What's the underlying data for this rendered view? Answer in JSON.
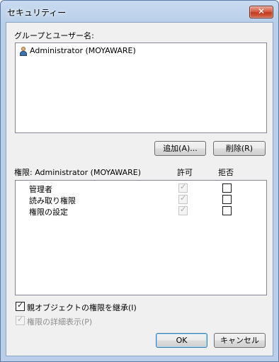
{
  "window": {
    "title": "セキュリティー",
    "close_glyph": "✕"
  },
  "users_section": {
    "label": "グループとユーザー名:",
    "users": [
      {
        "name": "Administrator (MOYAWARE)",
        "icon": "user-icon"
      }
    ]
  },
  "buttons": {
    "add": "追加(A)...",
    "remove": "削除(R)",
    "ok": "OK",
    "cancel": "キャンセル"
  },
  "permissions": {
    "title": "権限: Administrator (MOYAWARE)",
    "allow_header": "許可",
    "deny_header": "拒否",
    "rows": [
      {
        "name": "管理者",
        "allow": true,
        "allow_disabled": true,
        "deny": false
      },
      {
        "name": "読み取り権限",
        "allow": true,
        "allow_disabled": true,
        "deny": false
      },
      {
        "name": "権限の設定",
        "allow": true,
        "allow_disabled": true,
        "deny": false
      }
    ]
  },
  "options": {
    "inherit_label": "親オブジェクトの権限を継承(I)",
    "inherit_checked": true,
    "detail_label": "権限の詳細表示(P)",
    "detail_checked": true,
    "detail_disabled": true
  },
  "check_glyph": "✓",
  "colors": {
    "title_bar": "#b9cfe9",
    "close_button": "#c0391f",
    "dialog_bg": "#f0f0f0",
    "default_button_border": "#3c7fb1"
  }
}
